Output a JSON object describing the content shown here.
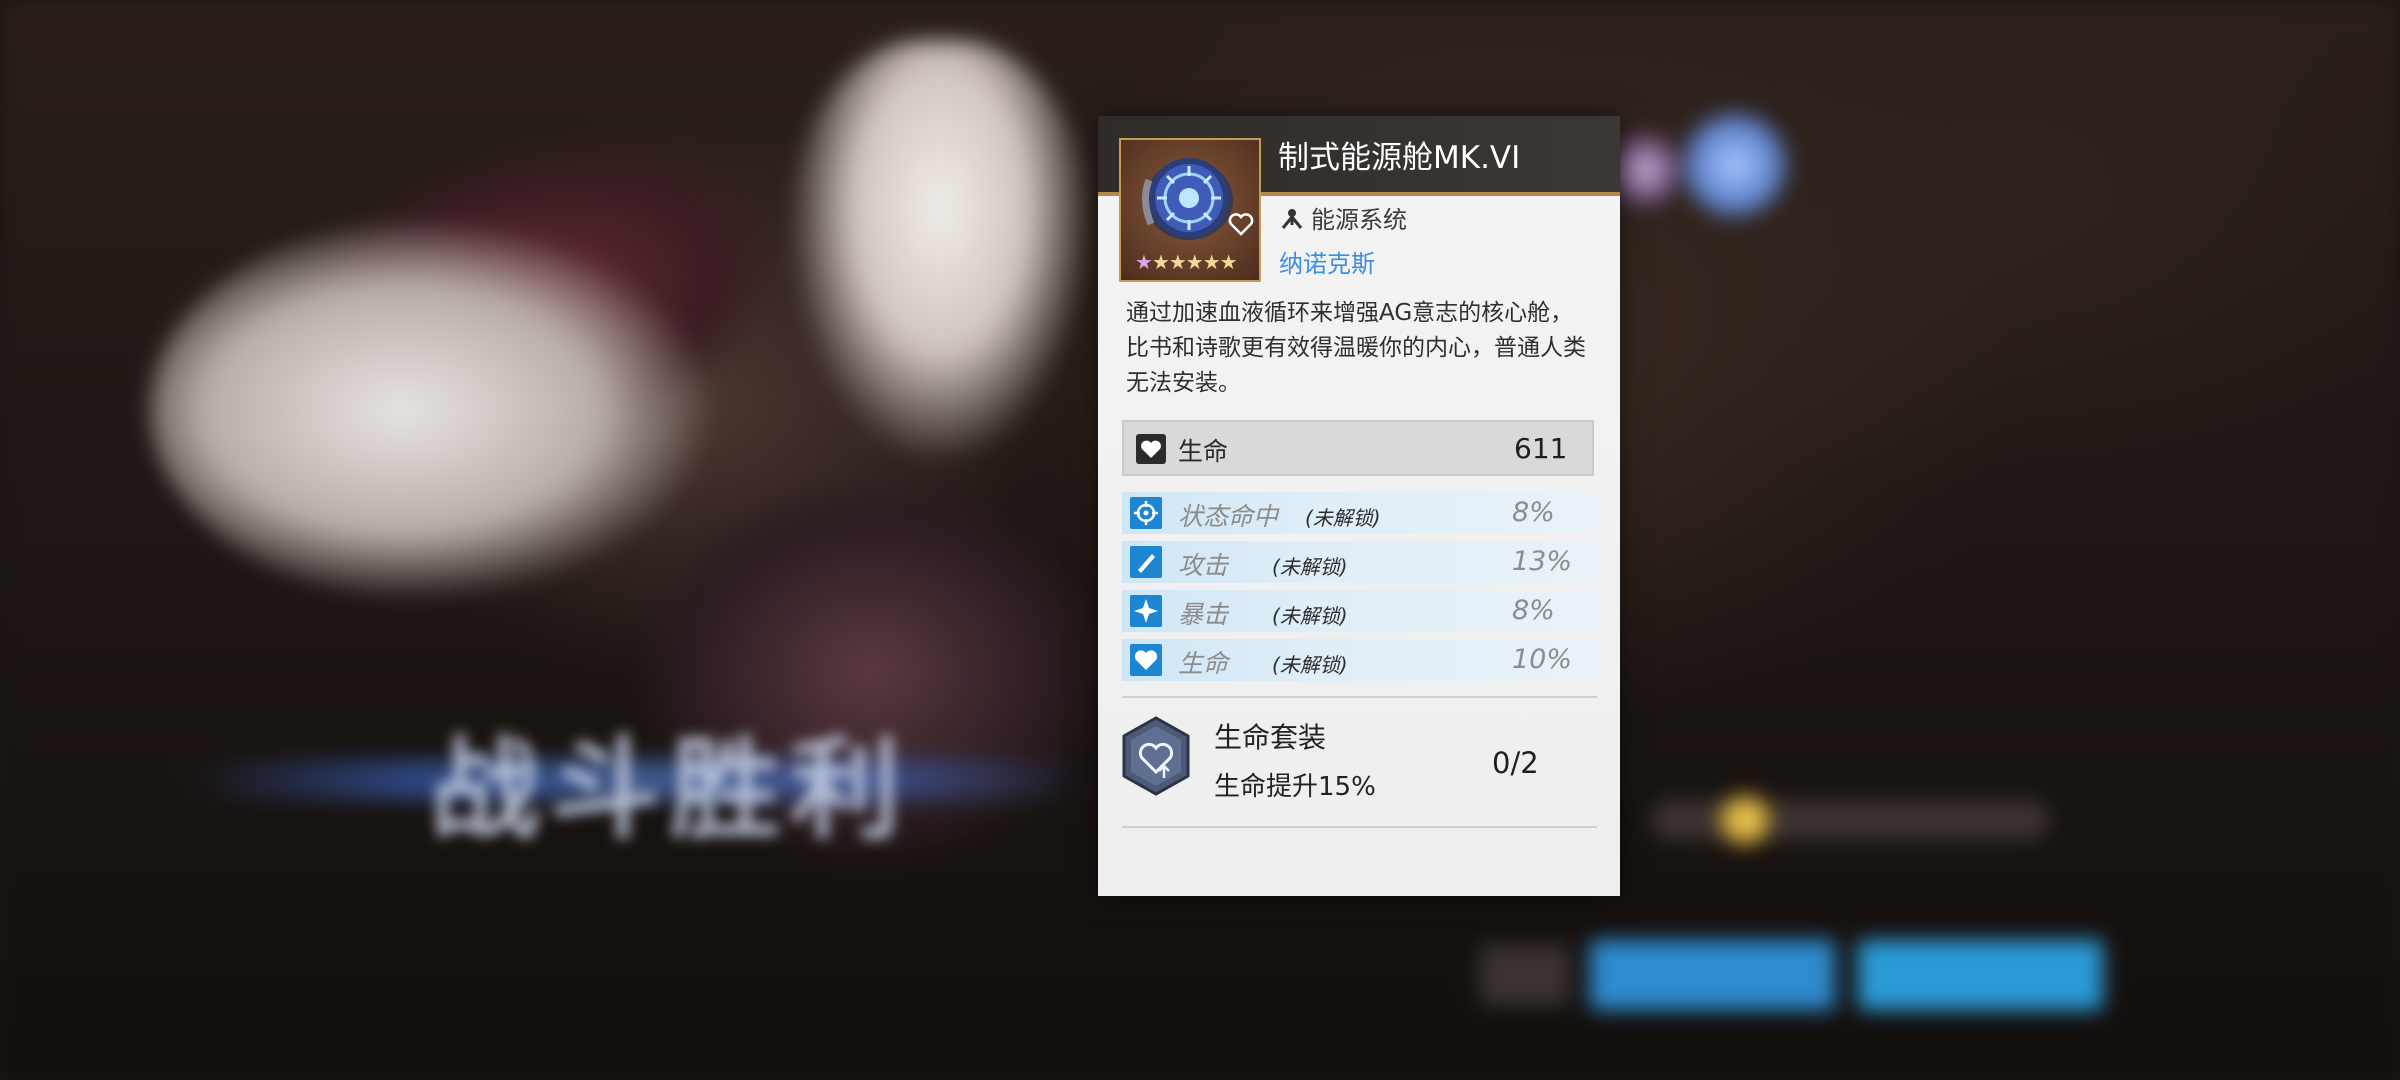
{
  "background": {
    "banner_text": "战斗胜利"
  },
  "item": {
    "name": "制式能源舱MK.VI",
    "category": "能源系统",
    "faction": "纳诺克斯",
    "stars": "★★★★★",
    "description": "通过加速血液循环来增强AG意志的核心舱，比书和诗歌更有效得温暖你的内心，普通人类无法安装。",
    "main_stat": {
      "name": "生命",
      "value": "611"
    },
    "sub_stats": [
      {
        "name": "状态命中",
        "lock": "(未解锁)",
        "value": "8%",
        "icon": "crosshair-icon"
      },
      {
        "name": "攻击",
        "lock": "(未解锁)",
        "value": "13%",
        "icon": "sword-icon"
      },
      {
        "name": "暴击",
        "lock": "(未解锁)",
        "value": "8%",
        "icon": "burst-icon"
      },
      {
        "name": "生命",
        "lock": "(未解锁)",
        "value": "10%",
        "icon": "heart-icon"
      }
    ],
    "set": {
      "name": "生命套装",
      "effect": "生命提升15%",
      "count": "0/2"
    }
  },
  "colors": {
    "accent_blue": "#1d86d2",
    "faction_blue": "#3f8fe0",
    "header_dark": "#2f2b28",
    "gold_border": "#b48a4a"
  }
}
